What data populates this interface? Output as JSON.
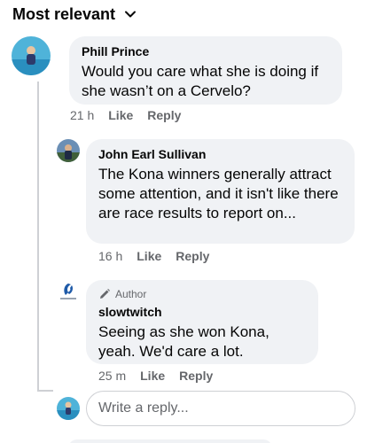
{
  "sort": {
    "label": "Most relevant",
    "icon": "chevron-down-icon"
  },
  "comments": [
    {
      "author": "Phill Prince",
      "text": "Would you care what she is doing if she wasn’t on a Cervelo?",
      "time": "21 h",
      "like": "Like",
      "reply": "Reply"
    },
    {
      "author": "John Earl Sullivan",
      "text": "The Kona winners generally attract some attention, and it isn't like there are race results to report on...",
      "time": "16 h",
      "like": "Like",
      "reply": "Reply"
    },
    {
      "author": "slowtwitch",
      "badge": "Author",
      "badge_icon": "pencil-icon",
      "text": "Seeing as she won Kona, yeah. We'd care a lot.",
      "time": "25 m",
      "like": "Like",
      "reply": "Reply"
    }
  ],
  "reply_box": {
    "placeholder": "Write a reply..."
  }
}
